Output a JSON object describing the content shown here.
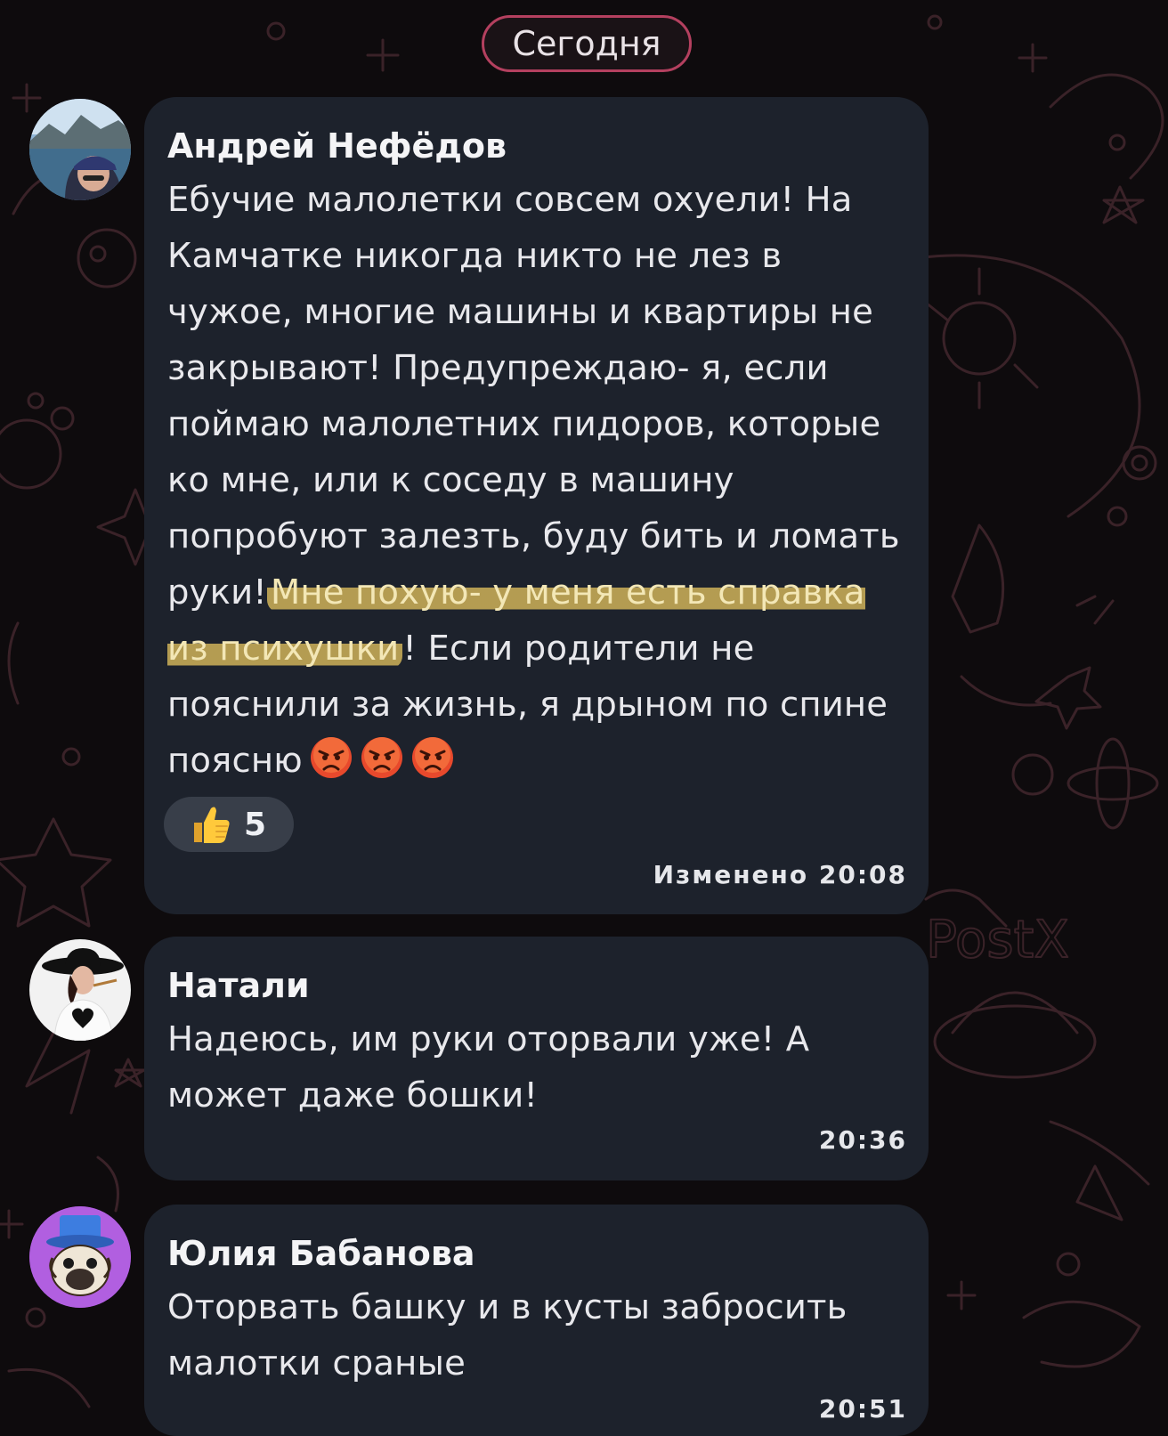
{
  "date_separator": "Сегодня",
  "messages": [
    {
      "sender": "Андрей Нефёдов",
      "text_before": "Ебучие малолетки совсем охуели! На Камчатке никогда никто не лез в чужое, многие машины и квартиры не закрывают! Предупреждаю- я, если поймаю малолетних пидоров, которые ко мне, или к соседу в машину попробуют залезть, буду бить и ломать руки!",
      "text_highlight": "Мне похую- у меня есть справка из психушки",
      "text_after": "! Если родители не пояснили за жизнь, я дрыном по спине поясню",
      "emoji": "angry-face-icon",
      "emoji_count": 3,
      "reaction": {
        "icon": "thumbs-up-icon",
        "count": "5"
      },
      "time": "Изменено 20:08"
    },
    {
      "sender": "Натали",
      "text": "Надеюсь, им руки оторвали уже! А может даже бошки!",
      "time": "20:36"
    },
    {
      "sender": "Юлия Бабанова",
      "text": "Оторвать башку и в кусты забросить малотки сраные",
      "time": "20:51"
    }
  ],
  "colors": {
    "background": "#0e0b0d",
    "bubble": "#1d222c",
    "date_border": "#b4405f",
    "highlight": "#debe5c"
  }
}
